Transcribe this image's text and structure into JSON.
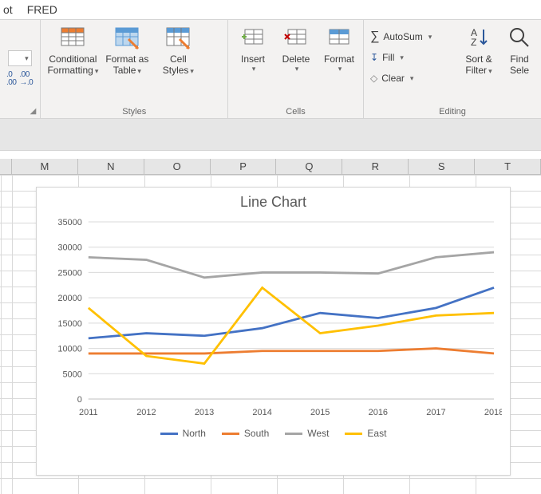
{
  "tabs": {
    "t1": "ot",
    "t2": "FRED"
  },
  "number_group": {
    "label": ""
  },
  "styles_group": {
    "label": "Styles",
    "conditional": {
      "l1": "Conditional",
      "l2": "Formatting"
    },
    "format_as": {
      "l1": "Format as",
      "l2": "Table"
    },
    "cell_styles": {
      "l1": "Cell",
      "l2": "Styles"
    }
  },
  "cells_group": {
    "label": "Cells",
    "insert": "Insert",
    "delete": "Delete",
    "format": "Format"
  },
  "editing_group": {
    "label": "Editing",
    "autosum": "AutoSum",
    "fill": "Fill",
    "clear": "Clear",
    "sort": {
      "l1": "Sort &",
      "l2": "Filter"
    },
    "find": {
      "l1": "Find",
      "l2": "Sele"
    }
  },
  "columns": [
    "M",
    "N",
    "O",
    "P",
    "Q",
    "R",
    "S",
    "T"
  ],
  "chart_data": {
    "type": "line",
    "title": "Line Chart",
    "xlabel": "",
    "ylabel": "",
    "ylim": [
      0,
      35000
    ],
    "ystep": 5000,
    "categories": [
      "2011",
      "2012",
      "2013",
      "2014",
      "2015",
      "2016",
      "2017",
      "2018"
    ],
    "series": [
      {
        "name": "North",
        "color": "#4472C4",
        "values": [
          12000,
          13000,
          12500,
          14000,
          17000,
          16000,
          18000,
          22000
        ]
      },
      {
        "name": "South",
        "color": "#ED7D31",
        "values": [
          9000,
          9000,
          9000,
          9500,
          9500,
          9500,
          10000,
          9000
        ]
      },
      {
        "name": "West",
        "color": "#A5A5A5",
        "values": [
          28000,
          27500,
          24000,
          25000,
          25000,
          24800,
          28000,
          29000
        ]
      },
      {
        "name": "East",
        "color": "#FFC000",
        "values": [
          18000,
          8500,
          7000,
          22000,
          13000,
          14500,
          16500,
          17000
        ]
      }
    ]
  }
}
